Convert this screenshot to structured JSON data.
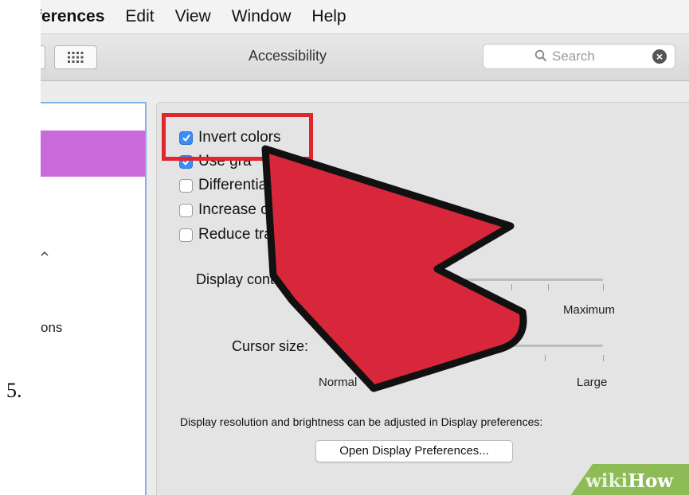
{
  "step_number": "5.",
  "menubar": {
    "app": "ferences",
    "items": [
      "Edit",
      "View",
      "Window",
      "Help"
    ]
  },
  "toolbar": {
    "title": "Accessibility",
    "search_placeholder": "Search"
  },
  "sidebar": {
    "items": [
      "ons"
    ]
  },
  "options": [
    {
      "label": "Invert colors",
      "checked": true
    },
    {
      "label": "Use gra",
      "checked": true
    },
    {
      "label": "Differentia",
      "checked": false
    },
    {
      "label": "Increase co",
      "checked": false
    },
    {
      "label": "Reduce trans",
      "checked": false
    }
  ],
  "display_contrast": {
    "label": "Display contrast:",
    "min_label": "N",
    "max_label": "Maximum",
    "value_fraction": 0.0
  },
  "cursor_size": {
    "label": "Cursor size:",
    "min_label": "Normal",
    "max_label": "Large",
    "value_fraction": 0.0
  },
  "display_note": "Display resolution and brightness can be adjusted in Display preferences:",
  "open_button": "Open Display Preferences...",
  "watermark": {
    "part1": "wiki",
    "part2": "How"
  },
  "colors": {
    "highlight_box": "#e0262f",
    "arrow_fill": "#d8273a",
    "sidebar_selection": "#c86ad9",
    "checkbox_on": "#3a8ef5",
    "watermark_bg": "#8dbb55"
  }
}
